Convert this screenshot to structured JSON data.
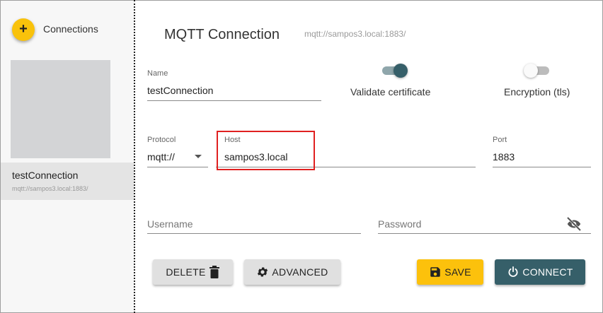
{
  "sidebar": {
    "add_button_label": "+",
    "title": "Connections",
    "connections": [
      {
        "name": "testConnection",
        "url": "mqtt://sampos3.local:1883/"
      }
    ]
  },
  "header": {
    "title": "MQTT Connection",
    "subtitle": "mqtt://sampos3.local:1883/"
  },
  "form": {
    "name": {
      "label": "Name",
      "value": "testConnection"
    },
    "validate_certificate": {
      "label": "Validate certificate",
      "enabled": true
    },
    "encryption": {
      "label": "Encryption (tls)",
      "enabled": false
    },
    "protocol": {
      "label": "Protocol",
      "value": "mqtt://"
    },
    "host": {
      "label": "Host",
      "value": "sampos3.local"
    },
    "port": {
      "label": "Port",
      "value": "1883"
    },
    "username": {
      "placeholder": "Username",
      "value": ""
    },
    "password": {
      "placeholder": "Password",
      "value": ""
    }
  },
  "actions": {
    "delete_label": "DELETE",
    "advanced_label": "ADVANCED",
    "save_label": "SAVE",
    "connect_label": "CONNECT"
  },
  "colors": {
    "accent_yellow": "#fcc10c",
    "toggle_on": "#365f69",
    "connect_button": "#365f69",
    "highlight_border": "#e02020"
  },
  "icons": {
    "add": "plus-icon",
    "delete": "trash-icon",
    "advanced": "gear-icon",
    "save": "floppy-disk-icon",
    "connect": "power-icon",
    "password_visibility": "eye-off-icon",
    "protocol_dropdown": "caret-down-icon"
  }
}
